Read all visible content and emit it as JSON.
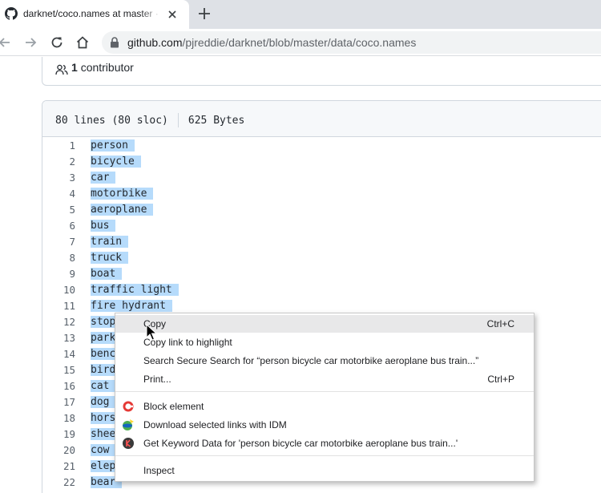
{
  "tab": {
    "title": "darknet/coco.names at master · pjreddie/darknet",
    "favicon": "github-icon",
    "close": "close-icon"
  },
  "toolbar": {
    "url_host": "github.com",
    "url_path": "/pjreddie/darknet/blob/master/data/coco.names"
  },
  "contributors": {
    "count": "1",
    "label": "contributor"
  },
  "file": {
    "lines_info": "80 lines (80 sloc)",
    "size": "625 Bytes"
  },
  "code_lines": [
    {
      "num": "1",
      "text": "person"
    },
    {
      "num": "2",
      "text": "bicycle"
    },
    {
      "num": "3",
      "text": "car"
    },
    {
      "num": "4",
      "text": "motorbike"
    },
    {
      "num": "5",
      "text": "aeroplane"
    },
    {
      "num": "6",
      "text": "bus"
    },
    {
      "num": "7",
      "text": "train"
    },
    {
      "num": "8",
      "text": "truck"
    },
    {
      "num": "9",
      "text": "boat"
    },
    {
      "num": "10",
      "text": "traffic light"
    },
    {
      "num": "11",
      "text": "fire hydrant"
    },
    {
      "num": "12",
      "text": "stop"
    },
    {
      "num": "13",
      "text": "park"
    },
    {
      "num": "14",
      "text": "benc"
    },
    {
      "num": "15",
      "text": "bird"
    },
    {
      "num": "16",
      "text": "cat"
    },
    {
      "num": "17",
      "text": "dog"
    },
    {
      "num": "18",
      "text": "hors"
    },
    {
      "num": "19",
      "text": "shee"
    },
    {
      "num": "20",
      "text": "cow"
    },
    {
      "num": "21",
      "text": "elep"
    },
    {
      "num": "22",
      "text": "bear"
    }
  ],
  "context_menu": {
    "copy": "Copy",
    "copy_shortcut": "Ctrl+C",
    "copy_link": "Copy link to highlight",
    "search": "Search Secure Search for “person bicycle car motorbike aeroplane bus train...”",
    "print": "Print...",
    "print_shortcut": "Ctrl+P",
    "block": "Block element",
    "idm": "Download selected links with IDM",
    "keyword": "Get Keyword Data for 'person bicycle car motorbike aeroplane bus train...'",
    "inspect": "Inspect"
  },
  "colors": {
    "selection": "#b6dbfb",
    "menu_hover": "#e8e8e9"
  }
}
